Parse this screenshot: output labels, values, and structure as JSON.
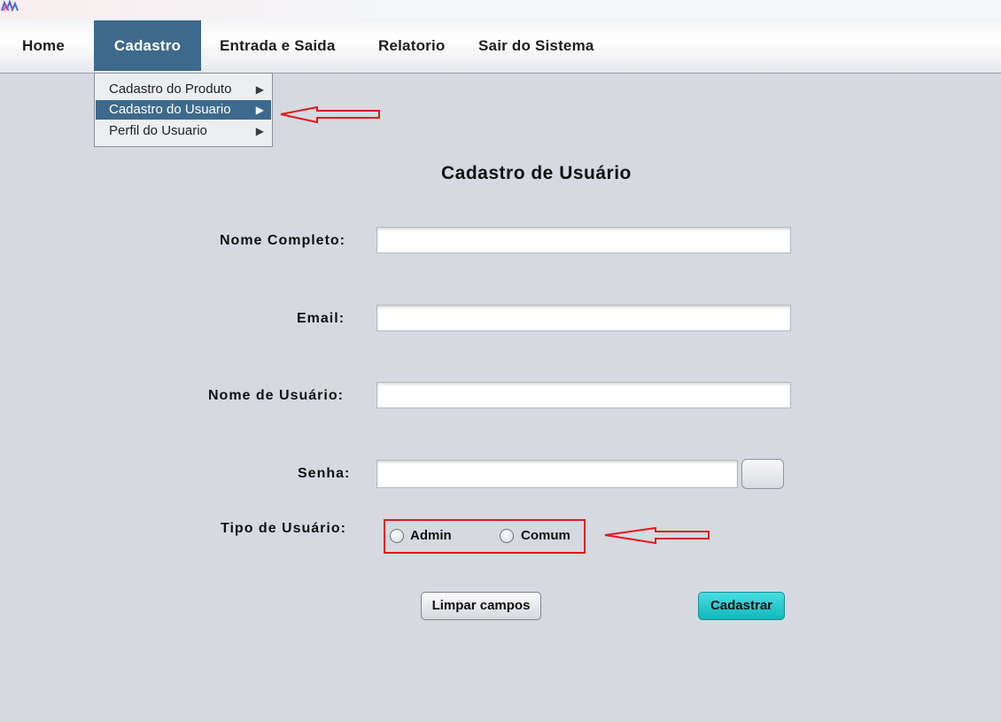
{
  "menubar": {
    "items": [
      {
        "label": "Home"
      },
      {
        "label": "Cadastro"
      },
      {
        "label": "Entrada e Saida"
      },
      {
        "label": "Relatorio"
      },
      {
        "label": "Sair do Sistema"
      }
    ],
    "active_item": "Cadastro"
  },
  "dropdown": {
    "items": [
      {
        "label": "Cadastro do Produto",
        "arrow": "▶"
      },
      {
        "label": "Cadastro do Usuario",
        "arrow": "▶"
      },
      {
        "label": "Perfil do Usuario",
        "arrow": "▶"
      }
    ],
    "selected_item": "Cadastro do Usuario"
  },
  "form": {
    "title": "Cadastro de Usuário",
    "fields": {
      "nome_completo": {
        "label": "Nome Completo:",
        "value": ""
      },
      "email": {
        "label": "Email:",
        "value": ""
      },
      "nome_usuario": {
        "label": "Nome de Usuário:",
        "value": ""
      },
      "senha": {
        "label": "Senha:",
        "value": ""
      }
    },
    "tipo_usuario": {
      "label": "Tipo de Usuário:",
      "options": [
        {
          "label": "Admin",
          "selected": false
        },
        {
          "label": "Comum",
          "selected": false
        }
      ]
    },
    "buttons": {
      "clear": "Limpar campos",
      "submit": "Cadastrar"
    }
  },
  "colors": {
    "background": "#d6d9e0",
    "menu_active": "#3d6a8c",
    "submit_button": "#1fc4c9",
    "annotation_red": "#e0191c"
  },
  "icons": {
    "app": "app-logo-icon",
    "submenu": "chevron-right-icon",
    "annotation": "arrow-left-icon"
  }
}
